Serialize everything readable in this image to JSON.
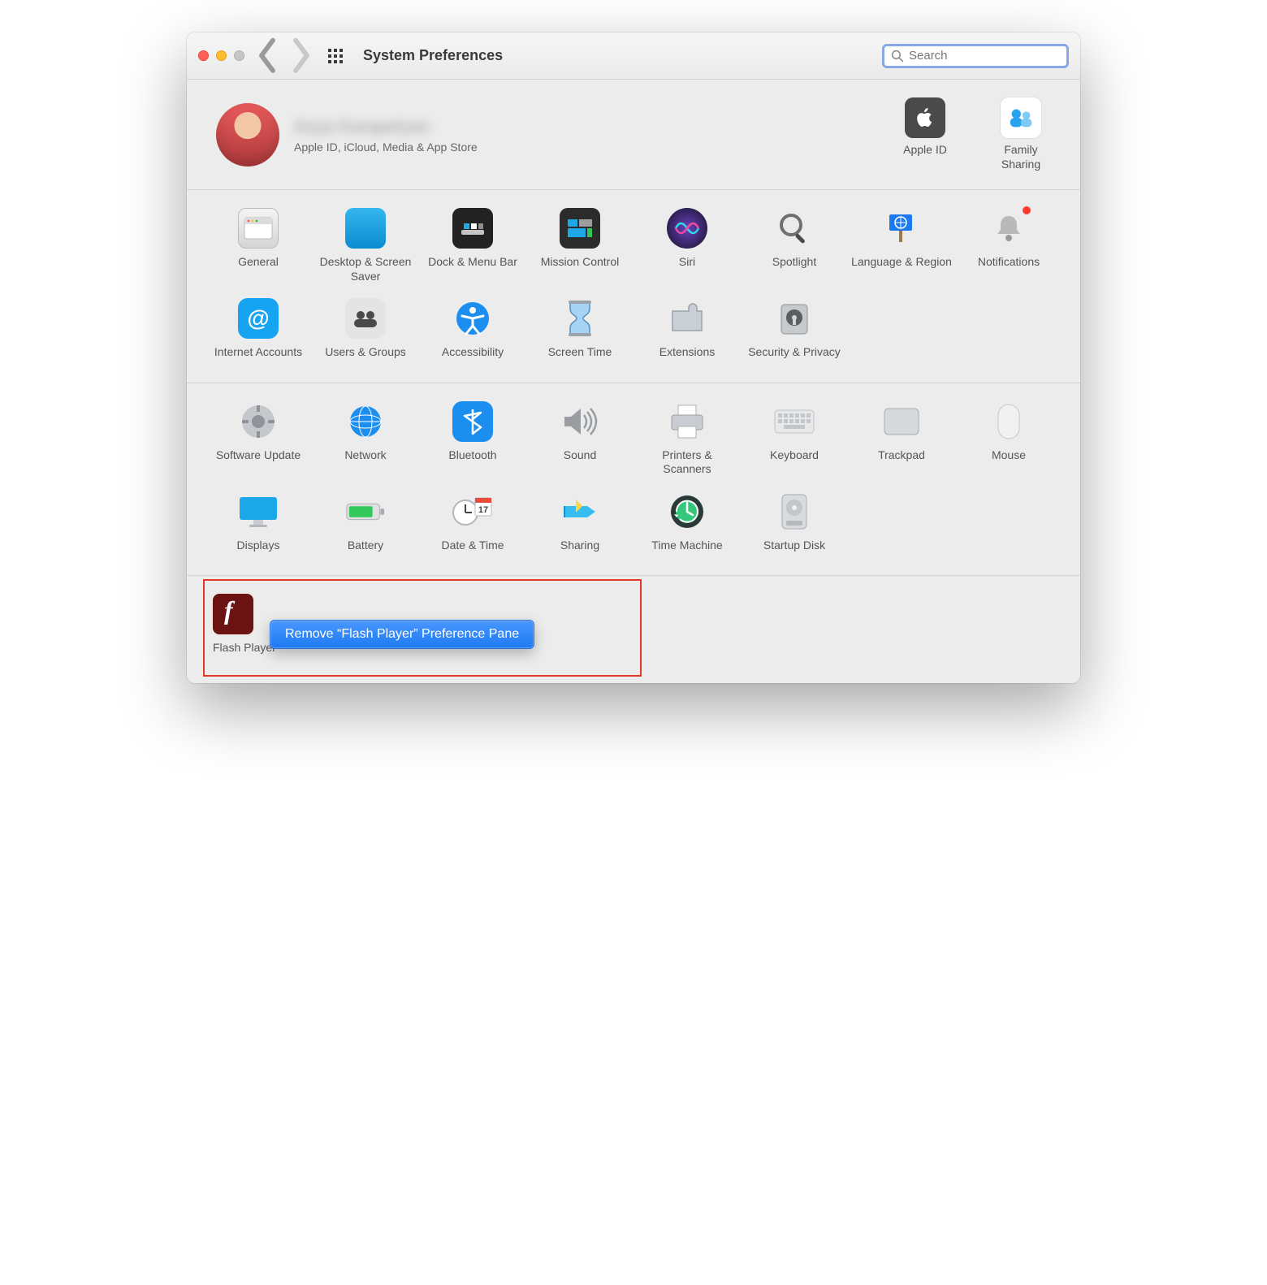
{
  "window": {
    "title": "System Preferences"
  },
  "search": {
    "placeholder": "Search"
  },
  "profile": {
    "name": "Asya Karapetyan",
    "subtitle": "Apple ID, iCloud, Media & App Store"
  },
  "header_items": [
    {
      "label": "Apple ID"
    },
    {
      "label": "Family Sharing"
    }
  ],
  "rows": {
    "a": [
      {
        "label": "General"
      },
      {
        "label": "Desktop & Screen Saver"
      },
      {
        "label": "Dock & Menu Bar"
      },
      {
        "label": "Mission Control"
      },
      {
        "label": "Siri"
      },
      {
        "label": "Spotlight"
      },
      {
        "label": "Language & Region"
      },
      {
        "label": "Notifications",
        "badge": true
      }
    ],
    "b": [
      {
        "label": "Internet Accounts"
      },
      {
        "label": "Users & Groups"
      },
      {
        "label": "Accessibility"
      },
      {
        "label": "Screen Time"
      },
      {
        "label": "Extensions"
      },
      {
        "label": "Security & Privacy"
      }
    ],
    "c": [
      {
        "label": "Software Update"
      },
      {
        "label": "Network"
      },
      {
        "label": "Bluetooth"
      },
      {
        "label": "Sound"
      },
      {
        "label": "Printers & Scanners"
      },
      {
        "label": "Keyboard"
      },
      {
        "label": "Trackpad"
      },
      {
        "label": "Mouse"
      }
    ],
    "d": [
      {
        "label": "Displays"
      },
      {
        "label": "Battery"
      },
      {
        "label": "Date & Time"
      },
      {
        "label": "Sharing"
      },
      {
        "label": "Time Machine"
      },
      {
        "label": "Startup Disk"
      }
    ]
  },
  "thirdparty": {
    "item_label": "Flash Player",
    "menu_text": "Remove “Flash Player” Preference Pane"
  }
}
